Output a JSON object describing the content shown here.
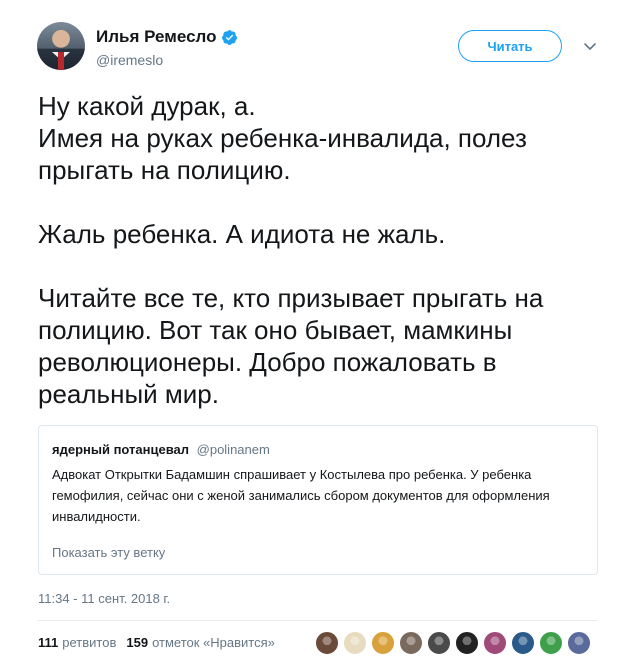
{
  "author": {
    "name": "Илья Ремесло",
    "handle": "@iremeslo",
    "verified": true
  },
  "follow_button": {
    "label": "Читать"
  },
  "tweet": {
    "text": "Ну какой дурак, а.\nИмея на руках ребенка-инвалида, полез\nпрыгать на полицию.\n\nЖаль ребенка. А идиота не жаль.\n\nЧитайте все те, кто призывает прыгать на\nполицию. Вот так оно бывает, мамкины\nреволюционеры. Добро пожаловать в\nреальный мир."
  },
  "quoted_tweet": {
    "name": "ядерный потанцевал",
    "handle": "@polinanem",
    "text": "Адвокат Открытки Бадамшин спрашивает у Костылева про ребенка. У ребенка гемофилия, сейчас они с женой занимались сбором документов для оформления инвалидности.",
    "show_thread": "Показать эту ветку"
  },
  "timestamp": "11:34 - 11 сент. 2018 г.",
  "stats": {
    "retweets_count": "111",
    "retweets_label": "ретвитов",
    "likes_count": "159",
    "likes_label": "отметок «Нравится»"
  },
  "likers": [
    {
      "color": "#6b4a3a"
    },
    {
      "color": "#e8dcc0"
    },
    {
      "color": "#d9a13b"
    },
    {
      "color": "#7a6a5e"
    },
    {
      "color": "#4a4a4a"
    },
    {
      "color": "#222222"
    },
    {
      "color": "#a04a7a"
    },
    {
      "color": "#2a5a8a"
    },
    {
      "color": "#3ea04a"
    },
    {
      "color": "#5a6a9a"
    }
  ],
  "colors": {
    "accent": "#1da1f2",
    "secondary_text": "#657786",
    "border": "#e1e8ed"
  },
  "icons": {
    "verified": "verified-badge-icon",
    "caret": "chevron-down-icon"
  }
}
